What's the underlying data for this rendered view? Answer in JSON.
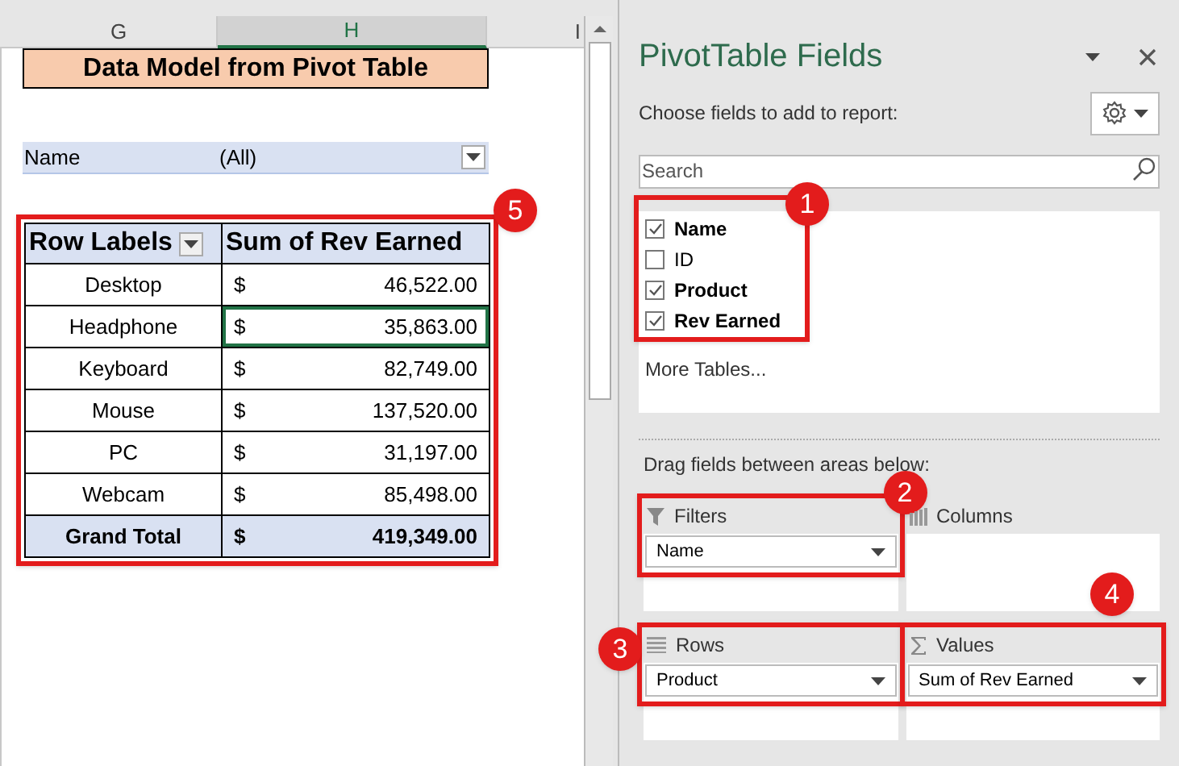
{
  "sheet": {
    "columns": [
      {
        "label": "G",
        "selected": false
      },
      {
        "label": "H",
        "selected": true
      },
      {
        "label": "I",
        "selected": false
      }
    ],
    "title": "Data Model from Pivot Table",
    "filter": {
      "label": "Name",
      "value": "(All)"
    },
    "pivot": {
      "callout": "5",
      "headers": [
        "Row Labels",
        "Sum of Rev Earned"
      ],
      "rows": [
        {
          "label": "Desktop",
          "currency": "$",
          "value": "46,522.00",
          "selected": false
        },
        {
          "label": "Headphone",
          "currency": "$",
          "value": "35,863.00",
          "selected": true
        },
        {
          "label": "Keyboard",
          "currency": "$",
          "value": "82,749.00",
          "selected": false
        },
        {
          "label": "Mouse",
          "currency": "$",
          "value": "137,520.00",
          "selected": false
        },
        {
          "label": "PC",
          "currency": "$",
          "value": "31,197.00",
          "selected": false
        },
        {
          "label": "Webcam",
          "currency": "$",
          "value": "85,498.00",
          "selected": false
        }
      ],
      "total": {
        "label": "Grand Total",
        "currency": "$",
        "value": "419,349.00"
      }
    }
  },
  "panel": {
    "title": "PivotTable Fields",
    "subtitle": "Choose fields to add to report:",
    "search": {
      "placeholder": "Search"
    },
    "fields_callout": "1",
    "fields": [
      {
        "label": "Name",
        "checked": true
      },
      {
        "label": "ID",
        "checked": false
      },
      {
        "label": "Product",
        "checked": true
      },
      {
        "label": "Rev Earned",
        "checked": true
      }
    ],
    "more_tables": "More Tables...",
    "drag_hint": "Drag fields between areas below:",
    "areas": [
      {
        "kind": "filters",
        "label": "Filters",
        "callout": "2",
        "items": [
          "Name"
        ]
      },
      {
        "kind": "columns",
        "label": "Columns"
      },
      {
        "kind": "rows",
        "label": "Rows",
        "callout": "3",
        "items": [
          "Product"
        ]
      },
      {
        "kind": "values",
        "label": "Values",
        "callout": "4",
        "items": [
          "Sum of Rev Earned"
        ]
      }
    ]
  }
}
